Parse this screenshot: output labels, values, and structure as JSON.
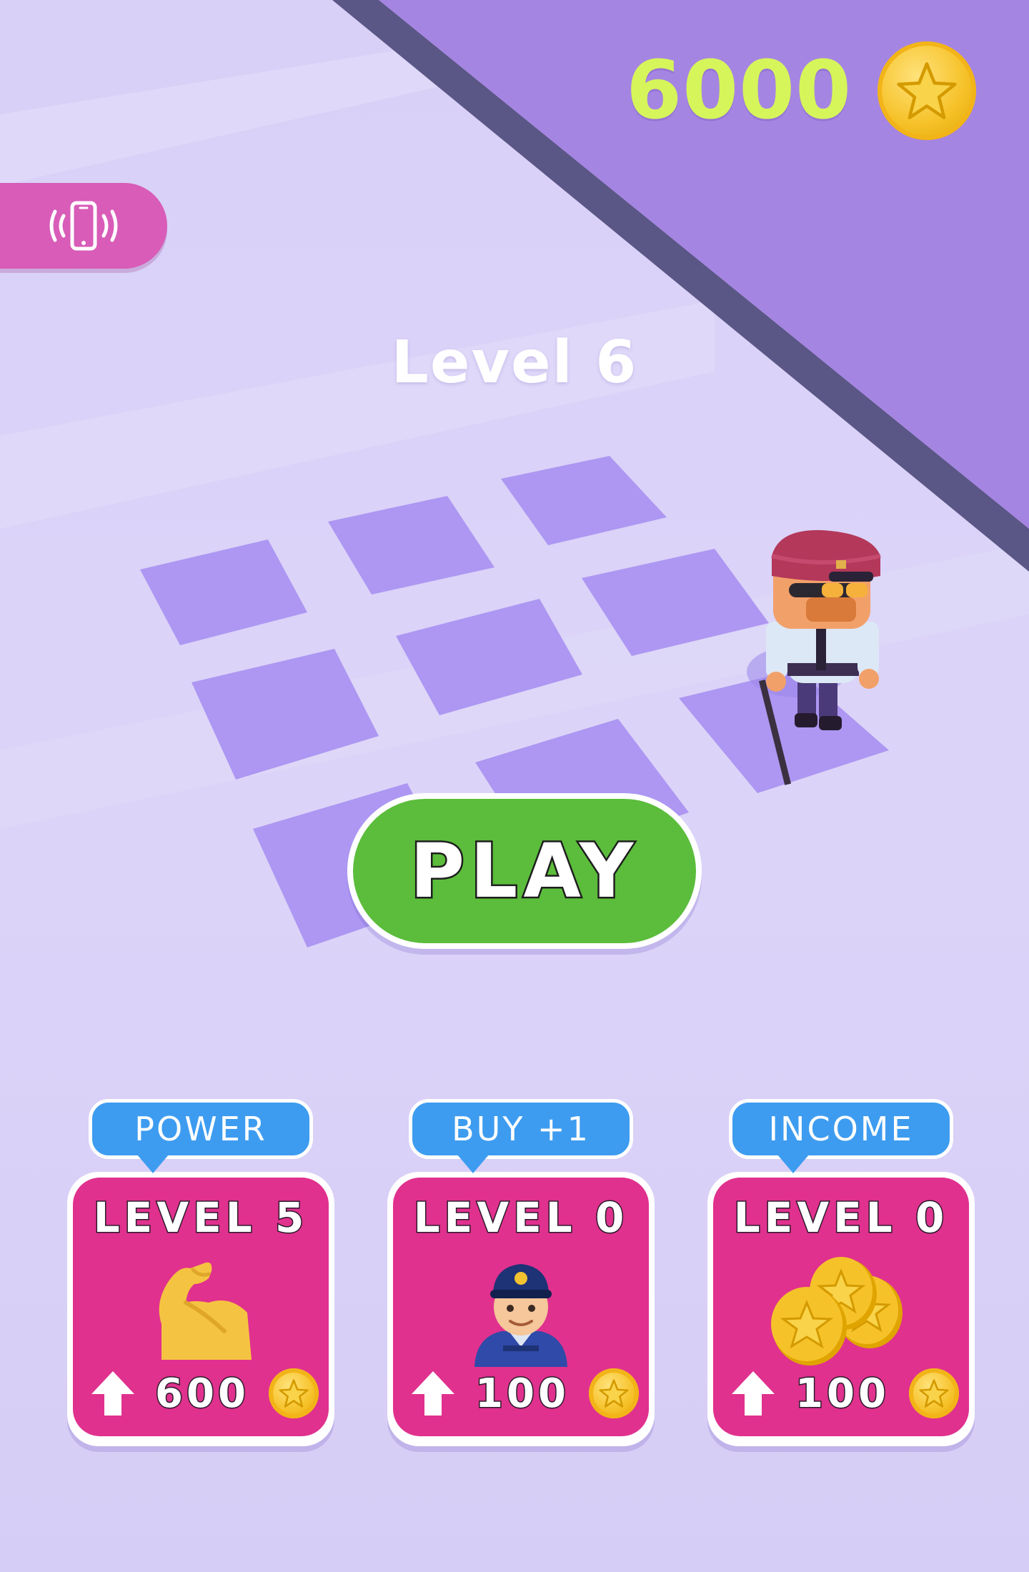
{
  "hud": {
    "coins": "6000",
    "coin_icon": "star-coin-icon",
    "vibrate_icon": "vibrate-phone-icon"
  },
  "level": {
    "title": "Level 6"
  },
  "play": {
    "label": "PLAY"
  },
  "upgrades": [
    {
      "tag": "POWER",
      "level": "LEVEL 5",
      "icon": "flexed-biceps-icon",
      "cost": "600"
    },
    {
      "tag": "BUY +1",
      "level": "LEVEL 0",
      "icon": "police-officer-icon",
      "cost": "100"
    },
    {
      "tag": "INCOME",
      "level": "LEVEL 0",
      "icon": "coins-stack-icon",
      "cost": "100"
    }
  ],
  "colors": {
    "background": "#d7cff6",
    "road": "#a585e2",
    "play": "#5bbd3b",
    "card": "#e0318e",
    "tag": "#3d9cf0",
    "coin_text": "#d6f55a"
  }
}
